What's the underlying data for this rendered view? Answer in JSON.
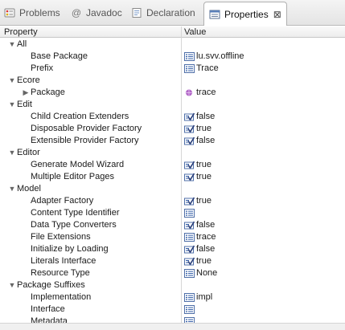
{
  "tabs": [
    {
      "label": "Problems",
      "icon": "problems-icon"
    },
    {
      "label": "Javadoc",
      "icon": "at-sign-icon"
    },
    {
      "label": "Declaration",
      "icon": "declaration-icon"
    },
    {
      "label": "Properties",
      "icon": "properties-icon",
      "active": true
    }
  ],
  "columns": {
    "property": "Property",
    "value": "Value"
  },
  "rows": [
    {
      "type": "category",
      "label": "All",
      "expanded": true
    },
    {
      "type": "prop",
      "label": "Base Package",
      "value": "lu.svv.offline",
      "icon": "text-icon"
    },
    {
      "type": "prop",
      "label": "Prefix",
      "value": "Trace",
      "icon": "text-icon"
    },
    {
      "type": "category",
      "label": "Ecore",
      "expanded": true
    },
    {
      "type": "subprop",
      "label": "Package",
      "value": "trace",
      "icon": "package-icon",
      "expanded": false
    },
    {
      "type": "category",
      "label": "Edit",
      "expanded": true
    },
    {
      "type": "prop",
      "label": "Child Creation Extenders",
      "value": "false",
      "icon": "boolean-icon"
    },
    {
      "type": "prop",
      "label": "Disposable Provider Factory",
      "value": "true",
      "icon": "boolean-icon"
    },
    {
      "type": "prop",
      "label": "Extensible Provider Factory",
      "value": "false",
      "icon": "boolean-icon"
    },
    {
      "type": "category",
      "label": "Editor",
      "expanded": true
    },
    {
      "type": "prop",
      "label": "Generate Model Wizard",
      "value": "true",
      "icon": "boolean-icon"
    },
    {
      "type": "prop",
      "label": "Multiple Editor Pages",
      "value": "true",
      "icon": "boolean-icon"
    },
    {
      "type": "category",
      "label": "Model",
      "expanded": true
    },
    {
      "type": "prop",
      "label": "Adapter Factory",
      "value": "true",
      "icon": "boolean-icon"
    },
    {
      "type": "prop",
      "label": "Content Type Identifier",
      "value": "",
      "icon": "text-icon"
    },
    {
      "type": "prop",
      "label": "Data Type Converters",
      "value": "false",
      "icon": "boolean-icon"
    },
    {
      "type": "prop",
      "label": "File Extensions",
      "value": "trace",
      "icon": "text-icon"
    },
    {
      "type": "prop",
      "label": "Initialize by Loading",
      "value": "false",
      "icon": "boolean-icon"
    },
    {
      "type": "prop",
      "label": "Literals Interface",
      "value": "true",
      "icon": "boolean-icon"
    },
    {
      "type": "prop",
      "label": "Resource Type",
      "value": "None",
      "icon": "text-icon"
    },
    {
      "type": "category",
      "label": "Package Suffixes",
      "expanded": true
    },
    {
      "type": "prop",
      "label": "Implementation",
      "value": "impl",
      "icon": "text-icon"
    },
    {
      "type": "prop",
      "label": "Interface",
      "value": "",
      "icon": "text-icon"
    },
    {
      "type": "prop",
      "label": "Metadata",
      "value": "",
      "icon": "text-icon"
    }
  ]
}
